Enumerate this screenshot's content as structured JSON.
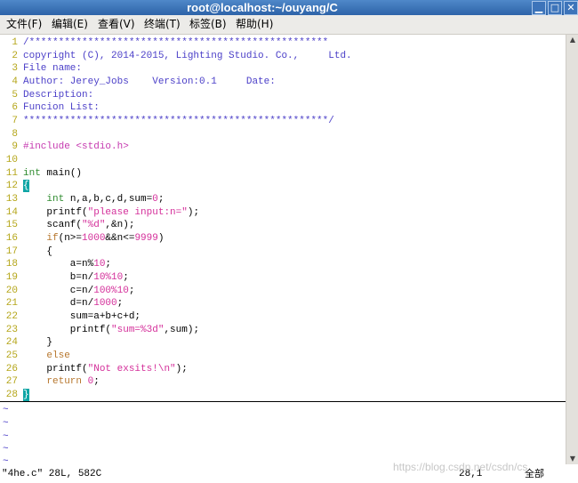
{
  "window": {
    "title": "root@localhost:~/ouyang/C",
    "minimize_glyph": "▁",
    "maximize_glyph": "□",
    "close_glyph": "✕"
  },
  "menu": {
    "file": "文件(F)",
    "edit": "编辑(E)",
    "view": "查看(V)",
    "terminal": "终端(T)",
    "tabs": "标签(B)",
    "help": "帮助(H)"
  },
  "editor": {
    "line_numbers": [
      "1",
      "2",
      "3",
      "4",
      "5",
      "6",
      "7",
      "8",
      "9",
      "10",
      "11",
      "12",
      "13",
      "14",
      "15",
      "16",
      "17",
      "18",
      "19",
      "20",
      "21",
      "22",
      "23",
      "24",
      "25",
      "26",
      "27",
      "28"
    ],
    "lines": {
      "l1": "/***************************************************",
      "l2": "copyright (C), 2014-2015, Lighting Studio. Co.,     Ltd.",
      "l3": "File name:",
      "l4": "Author: Jerey_Jobs    Version:0.1     Date:",
      "l5": "Description:",
      "l6": "Funcion List:",
      "l7": "****************************************************/",
      "l8": "",
      "l9_pre": "#include <stdio.h>",
      "l10": "",
      "l11_type": "int",
      "l11_rest": " main()",
      "l12_cursor": "{",
      "l13_indent": "    ",
      "l13_type": "int",
      "l13_rest": " n,a,b,c,d,sum=",
      "l13_num": "0",
      "l13_end": ";",
      "l14_a": "    printf(",
      "l14_str": "\"please input:n=\"",
      "l14_b": ");",
      "l15_a": "    scanf(",
      "l15_str": "\"%d\"",
      "l15_b": ",&n);",
      "l16_indent": "    ",
      "l16_kw": "if",
      "l16_a": "(n>=",
      "l16_n1": "1000",
      "l16_b": "&&n<=",
      "l16_n2": "9999",
      "l16_c": ")",
      "l17": "    {",
      "l18_a": "        a=n%",
      "l18_n": "10",
      "l18_b": ";",
      "l19_a": "        b=n/",
      "l19_n": "10%10",
      "l19_b": ";",
      "l20_a": "        c=n/",
      "l20_n": "100%10",
      "l20_b": ";",
      "l21_a": "        d=n/",
      "l21_n": "1000",
      "l21_b": ";",
      "l22": "        sum=a+b+c+d;",
      "l23_a": "        printf(",
      "l23_str": "\"sum=%3d\"",
      "l23_b": ",sum);",
      "l24": "    }",
      "l25_indent": "    ",
      "l25_kw": "else",
      "l26_a": "    printf(",
      "l26_str": "\"Not exsits!\\n\"",
      "l26_b": ");",
      "l27_indent": "    ",
      "l27_kw": "return",
      "l27_sp": " ",
      "l27_num": "0",
      "l27_end": ";",
      "l28_cursor": "}"
    },
    "tilde": "~"
  },
  "status": {
    "file_info": "\"4he.c\" 28L, 582C",
    "position": "28,1",
    "scroll": "全部",
    "watermark": "https://blog.csdn.net/csdn/cs"
  }
}
